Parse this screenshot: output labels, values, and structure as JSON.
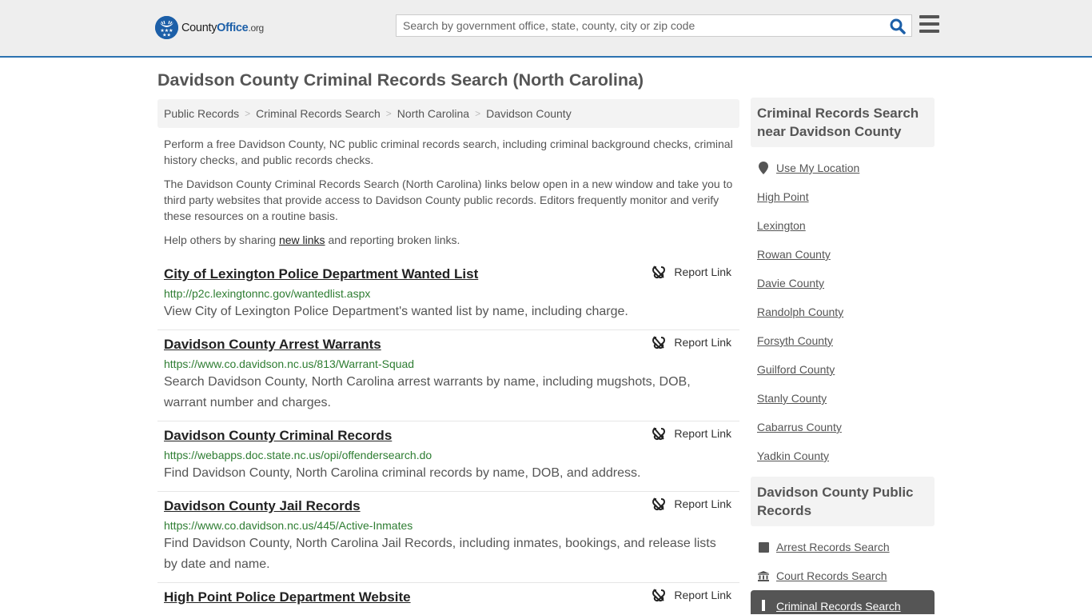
{
  "header": {
    "logo": {
      "county": "County",
      "office": "Office",
      "org": ".org"
    },
    "search": {
      "placeholder": "Search by government office, state, county, city or zip code",
      "value": ""
    },
    "colors": {
      "accent": "#2c72b0",
      "brand": "#1c5fa8",
      "header_bg": "#eeeeee"
    }
  },
  "page": {
    "title": "Davidson County Criminal Records Search (North Carolina)"
  },
  "breadcrumb": [
    {
      "label": "Public Records"
    },
    {
      "label": "Criminal Records Search"
    },
    {
      "label": "North Carolina"
    },
    {
      "label": "Davidson County"
    }
  ],
  "intro": {
    "p1": "Perform a free Davidson County, NC public criminal records search, including criminal background checks, criminal history checks, and public records checks.",
    "p2": "The Davidson County Criminal Records Search (North Carolina) links below open in a new window and take you to third party websites that provide access to Davidson County public records. Editors frequently monitor and verify these resources on a routine basis.",
    "p3_before": "Help others by sharing ",
    "p3_link": "new links",
    "p3_after": " and reporting broken links."
  },
  "results": [
    {
      "title": "City of Lexington Police Department Wanted List",
      "url": "http://p2c.lexingtonnc.gov/wantedlist.aspx",
      "description": "View City of Lexington Police Department's wanted list by name, including charge.",
      "report_label": "Report Link"
    },
    {
      "title": "Davidson County Arrest Warrants",
      "url": "https://www.co.davidson.nc.us/813/Warrant-Squad",
      "description": "Search Davidson County, North Carolina arrest warrants by name, including mugshots, DOB, warrant number and charges.",
      "report_label": "Report Link"
    },
    {
      "title": "Davidson County Criminal Records",
      "url": "https://webapps.doc.state.nc.us/opi/offendersearch.do",
      "description": "Find Davidson County, North Carolina criminal records by name, DOB, and address.",
      "report_label": "Report Link"
    },
    {
      "title": "Davidson County Jail Records",
      "url": "https://www.co.davidson.nc.us/445/Active-Inmates",
      "description": "Find Davidson County, North Carolina Jail Records, including inmates, bookings, and release lists by date and name.",
      "report_label": "Report Link"
    },
    {
      "title": "High Point Police Department Website",
      "url": "",
      "description": "",
      "report_label": "Report Link"
    }
  ],
  "sidebar": {
    "nearby": {
      "heading": "Criminal Records Search near Davidson County",
      "use_location": "Use My Location",
      "items": [
        "High Point",
        "Lexington",
        "Rowan County",
        "Davie County",
        "Randolph County",
        "Forsyth County",
        "Guilford County",
        "Stanly County",
        "Cabarrus County",
        "Yadkin County"
      ]
    },
    "public_records": {
      "heading": "Davidson County Public Records",
      "items": [
        {
          "label": "Arrest Records Search",
          "icon": "square-icon"
        },
        {
          "label": "Court Records Search",
          "icon": "courthouse-icon"
        },
        {
          "label": "Criminal Records Search",
          "icon": "exclamation-icon",
          "active": true
        }
      ]
    }
  }
}
